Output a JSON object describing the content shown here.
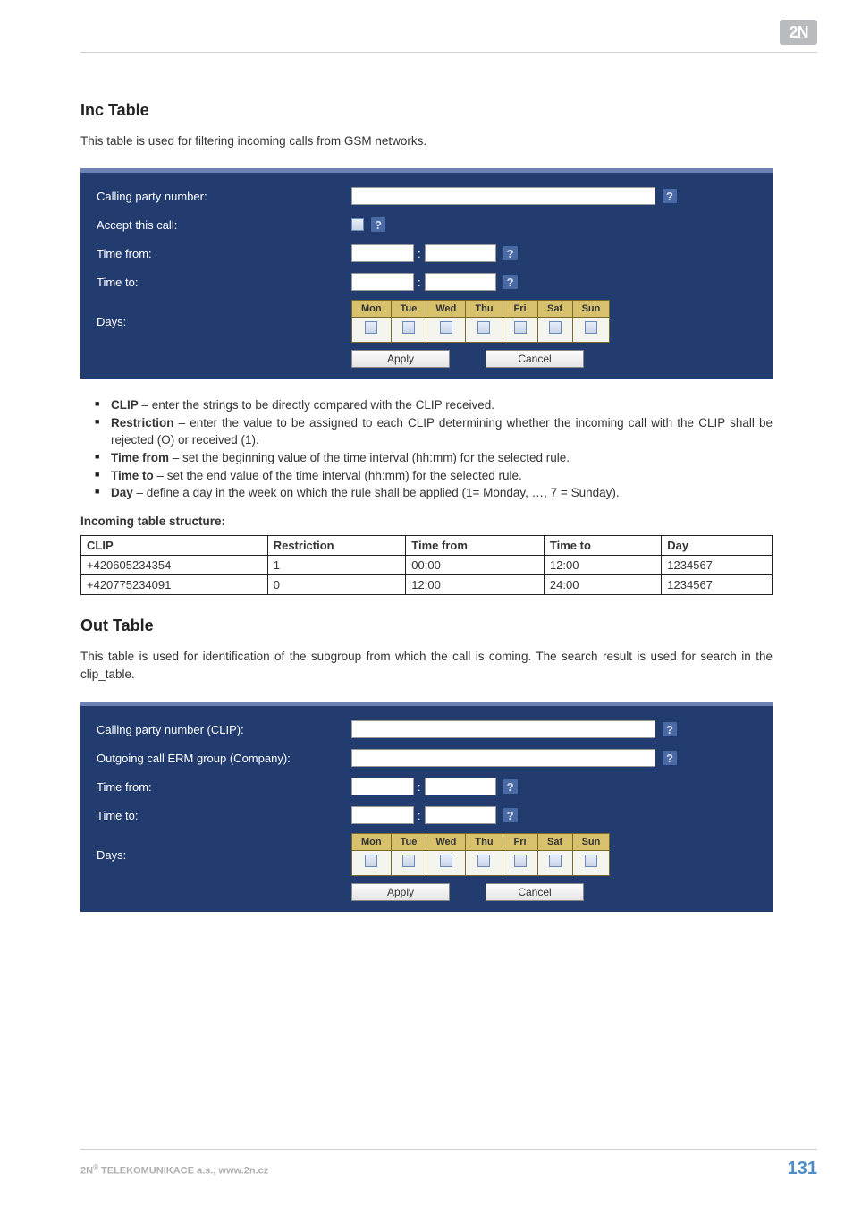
{
  "logo_text": "2N",
  "inc": {
    "heading": "Inc Table",
    "desc": "This table is used for filtering incoming calls from GSM networks.",
    "labels": {
      "calling": "Calling party number:",
      "accept": "Accept this call:",
      "time_from": "Time from:",
      "time_to": "Time to:",
      "days": "Days:"
    }
  },
  "days": [
    "Mon",
    "Tue",
    "Wed",
    "Thu",
    "Fri",
    "Sat",
    "Sun"
  ],
  "buttons": {
    "apply": "Apply",
    "cancel": "Cancel"
  },
  "help": "?",
  "bullets": [
    {
      "term": "CLIP",
      "text": " – enter the strings to be directly compared with the CLIP received."
    },
    {
      "term": "Restriction",
      "text": " – enter the value to be assigned to each CLIP determining whether the incoming call with the CLIP shall be rejected (O) or received (1)."
    },
    {
      "term": "Time from",
      "text": " – set the beginning value of the time interval (hh:mm) for the selected rule."
    },
    {
      "term": "Time to",
      "text": " – set the end value of the time interval (hh:mm) for the selected rule."
    },
    {
      "term": "Day",
      "text": " – define a day in the week on which the rule shall be applied (1= Monday, …, 7 = Sunday)."
    }
  ],
  "structure_heading": "Incoming table structure:",
  "table": {
    "headers": [
      "CLIP",
      "Restriction",
      "Time from",
      "Time to",
      "Day"
    ],
    "rows": [
      [
        "+420605234354",
        "1",
        "00:00",
        "12:00",
        "1234567"
      ],
      [
        "+420775234091",
        "0",
        "12:00",
        "24:00",
        "1234567"
      ]
    ]
  },
  "out": {
    "heading": "Out Table",
    "desc": "This table is used for identification of the subgroup from which the call is coming. The search result is used for search in the clip_table.",
    "labels": {
      "calling": "Calling party number (CLIP):",
      "erm": "Outgoing call ERM group (Company):",
      "time_from": "Time from:",
      "time_to": "Time to:",
      "days": "Days:"
    }
  },
  "footer": {
    "left_a": "2N",
    "left_b": " TELEKOMUNIKACE a.s., www.2n.cz",
    "page": "131"
  }
}
